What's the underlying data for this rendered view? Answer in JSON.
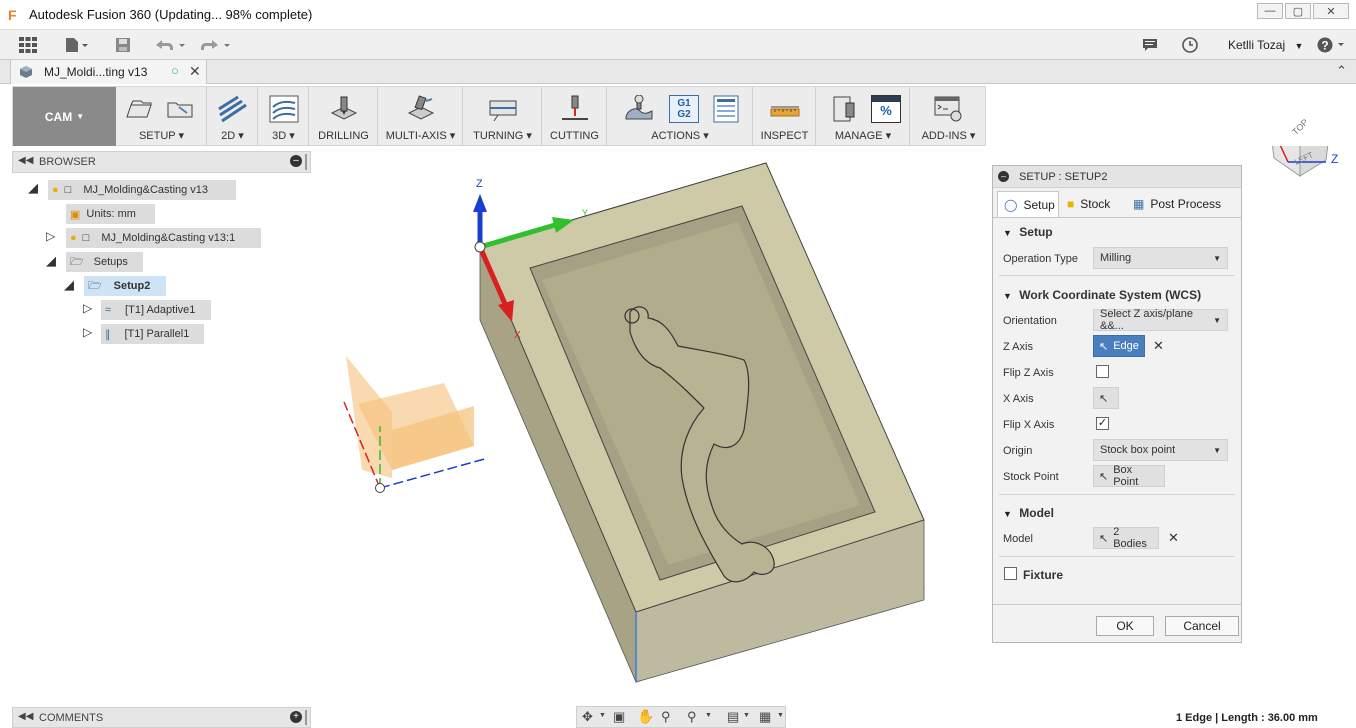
{
  "window": {
    "title": "Autodesk Fusion 360  (Updating... 98% complete)",
    "app_icon_letter": "F"
  },
  "topbar": {
    "user": "Ketlli Tozaj"
  },
  "tabs": [
    {
      "label": "MJ_Moldi...ting v13"
    }
  ],
  "ribbon": {
    "workspace": "CAM",
    "groups": [
      {
        "label": "SETUP"
      },
      {
        "label": "2D"
      },
      {
        "label": "3D"
      },
      {
        "label": "DRILLING"
      },
      {
        "label": "MULTI-AXIS"
      },
      {
        "label": "TURNING"
      },
      {
        "label": "CUTTING"
      },
      {
        "label": "ACTIONS"
      },
      {
        "label": "INSPECT"
      },
      {
        "label": "MANAGE"
      },
      {
        "label": "ADD-INS"
      }
    ],
    "g1g2_top": "G1",
    "g1g2_bottom": "G2",
    "manage_pct": "%"
  },
  "browser": {
    "header": "BROWSER",
    "nodes": {
      "root": "MJ_Molding&Casting v13",
      "units": "Units: mm",
      "component": "MJ_Molding&Casting v13:1",
      "setups": "Setups",
      "setup2": "Setup2",
      "op1": "[T1] Adaptive1",
      "op2": "[T1] Parallel1"
    }
  },
  "viewcube": {
    "top": "TOP",
    "left": "LEFT",
    "z": "Z"
  },
  "axes": {
    "z": "Z",
    "y": "Y",
    "x": "X"
  },
  "panel": {
    "header": "SETUP : SETUP2",
    "tabs": [
      "Setup",
      "Stock",
      "Post Process"
    ],
    "setup_section": "Setup",
    "operation_type_label": "Operation Type",
    "operation_type_value": "Milling",
    "wcs_section": "Work Coordinate System (WCS)",
    "orientation_label": "Orientation",
    "orientation_value": "Select Z axis/plane &&...",
    "z_axis_label": "Z Axis",
    "z_axis_value": "Edge",
    "flip_z_label": "Flip Z Axis",
    "x_axis_label": "X Axis",
    "flip_x_label": "Flip X Axis",
    "origin_label": "Origin",
    "origin_value": "Stock box point",
    "stock_point_label": "Stock Point",
    "stock_point_value": "Box Point",
    "model_section": "Model",
    "model_label": "Model",
    "model_value": "2 Bodies",
    "fixture_label": "Fixture",
    "ok_label": "OK",
    "cancel_label": "Cancel",
    "flip_x_check": "✓"
  },
  "comments": {
    "label": "COMMENTS"
  },
  "status": {
    "text": "1 Edge | Length : 36.00 mm"
  }
}
